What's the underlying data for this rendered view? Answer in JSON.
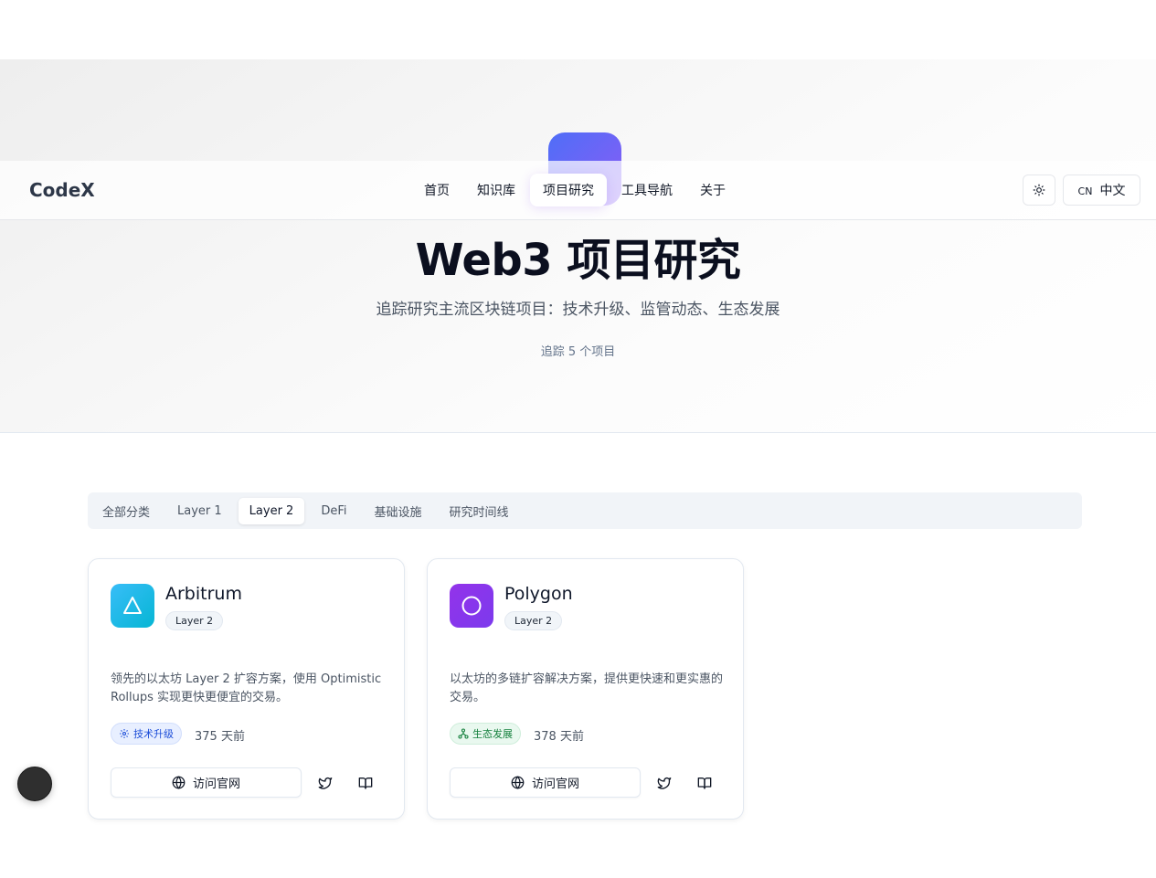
{
  "hero": {
    "title": "Web3 项目研究",
    "subtitle": "追踪研究主流区块链项目：技术升级、监管动态、生态发展",
    "count": "追踪 5 个项目",
    "logo_gradient": [
      "#4f6ef7",
      "#8b5cf6"
    ]
  },
  "navbar": {
    "brand": "CodeX",
    "links": [
      {
        "label": "首页",
        "active": false
      },
      {
        "label": "知识库",
        "active": false
      },
      {
        "label": "项目研究",
        "active": true
      },
      {
        "label": "工具导航",
        "active": false
      },
      {
        "label": "关于",
        "active": false
      }
    ],
    "theme_icon": "sun-icon",
    "lang": {
      "code": "CN",
      "label": "中文"
    }
  },
  "tabs": [
    {
      "label": "全部分类",
      "active": false
    },
    {
      "label": "Layer 1",
      "active": false
    },
    {
      "label": "Layer 2",
      "active": true
    },
    {
      "label": "DeFi",
      "active": false
    },
    {
      "label": "基础设施",
      "active": false
    },
    {
      "label": "研究时间线",
      "active": false
    }
  ],
  "projects": [
    {
      "name": "Arbitrum",
      "category": "Layer 2",
      "description": "领先的以太坊 Layer 2 扩容方案，使用 Optimistic Rollups 实现更快更便宜的交易。",
      "tag": "技术升级",
      "tag_icon": "gear-icon",
      "tag_color": "#1d4ed8",
      "updated": "375 天前",
      "icon": "triangle-icon",
      "icon_gradient": [
        "#38bdf8",
        "#06b6d4"
      ],
      "visit_label": "访问官网"
    },
    {
      "name": "Polygon",
      "category": "Layer 2",
      "description": "以太坊的多链扩容解决方案，提供更快速和更实惠的交易。",
      "tag": "生态发展",
      "tag_icon": "network-icon",
      "tag_color": "#15803d",
      "updated": "378 天前",
      "icon": "circle-icon",
      "icon_gradient": [
        "#9333ea",
        "#7c3aed"
      ],
      "visit_label": "访问官网"
    }
  ]
}
